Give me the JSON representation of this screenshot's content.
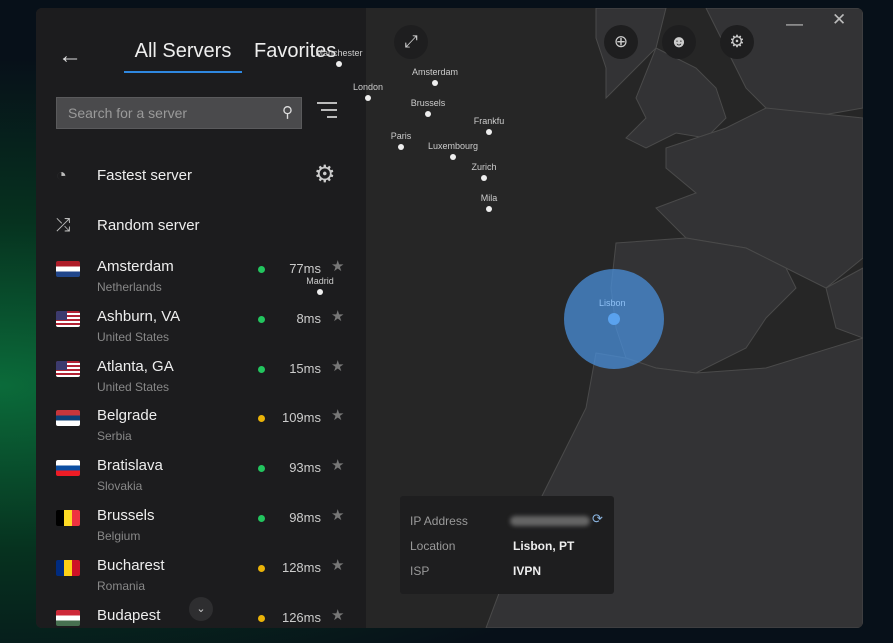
{
  "header": {
    "tabs": [
      "All Servers",
      "Favorites"
    ],
    "active_tab": "All Servers"
  },
  "search": {
    "placeholder": "Search for a server"
  },
  "options": {
    "fastest": "Fastest server",
    "random": "Random server"
  },
  "servers": [
    {
      "city": "Amsterdam",
      "country": "Netherlands",
      "latency": "77ms",
      "status": "#22c55e",
      "flag": "nl"
    },
    {
      "city": "Ashburn, VA",
      "country": "United States",
      "latency": "8ms",
      "status": "#22c55e",
      "flag": "us"
    },
    {
      "city": "Atlanta, GA",
      "country": "United States",
      "latency": "15ms",
      "status": "#22c55e",
      "flag": "us"
    },
    {
      "city": "Belgrade",
      "country": "Serbia",
      "latency": "109ms",
      "status": "#eab308",
      "flag": "rs"
    },
    {
      "city": "Bratislava",
      "country": "Slovakia",
      "latency": "93ms",
      "status": "#22c55e",
      "flag": "sk"
    },
    {
      "city": "Brussels",
      "country": "Belgium",
      "latency": "98ms",
      "status": "#22c55e",
      "flag": "be"
    },
    {
      "city": "Bucharest",
      "country": "Romania",
      "latency": "128ms",
      "status": "#eab308",
      "flag": "ro"
    },
    {
      "city": "Budapest",
      "country": "",
      "latency": "126ms",
      "status": "#eab308",
      "flag": "hu"
    }
  ],
  "map": {
    "cities": [
      "Manchester",
      "London",
      "Amsterdam",
      "Brussels",
      "Frankfu",
      "Paris",
      "Luxembourg",
      "Zurich",
      "Mila",
      "Madrid"
    ],
    "selected": "Lisbon",
    "accent": "#4a8fd9"
  },
  "info": {
    "ip_label": "IP Address",
    "location_label": "Location",
    "location": "Lisbon, PT",
    "isp_label": "ISP",
    "isp": "IVPN"
  }
}
